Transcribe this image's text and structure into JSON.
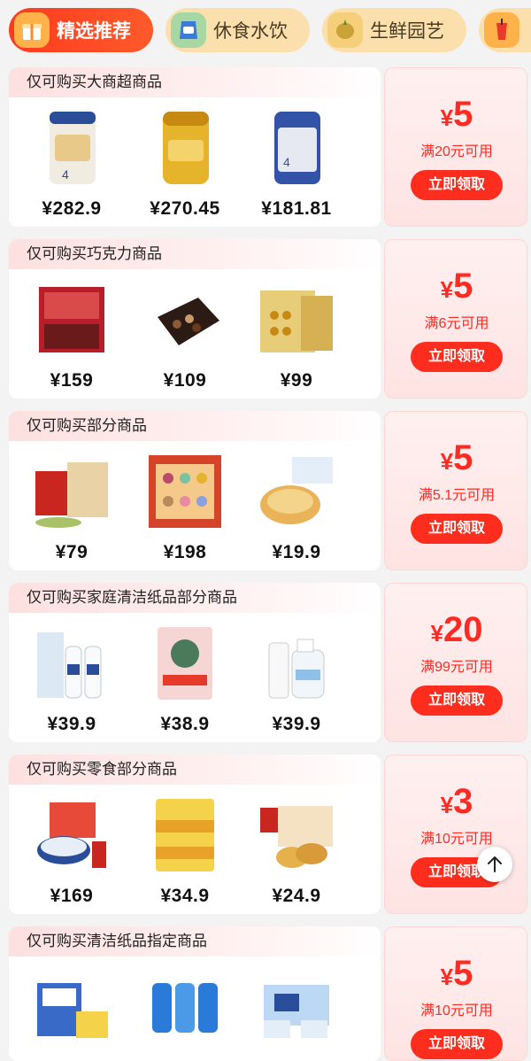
{
  "tabs": [
    {
      "label": "精选推荐",
      "icon": "gift-box-icon",
      "active": true
    },
    {
      "label": "休食水饮",
      "icon": "snack-bag-icon",
      "active": false
    },
    {
      "label": "生鲜园艺",
      "icon": "durian-icon",
      "active": false
    },
    {
      "label": "",
      "icon": "drink-cup-icon",
      "active": false
    }
  ],
  "cards": [
    {
      "title": "仅可购买大商超商品",
      "amount": "5",
      "currency": "¥",
      "condition": "满20元可用",
      "button": "立即领取",
      "products": [
        {
          "price": "¥282.9",
          "image": "infant-formula-can"
        },
        {
          "price": "¥270.45",
          "image": "gold-formula-can"
        },
        {
          "price": "¥181.81",
          "image": "blue-formula-can"
        }
      ]
    },
    {
      "title": "仅可购买巧克力商品",
      "amount": "5",
      "currency": "¥",
      "condition": "满6元可用",
      "button": "立即领取",
      "products": [
        {
          "price": "¥159",
          "image": "red-chocolate-box"
        },
        {
          "price": "¥109",
          "image": "dark-chocolate-box"
        },
        {
          "price": "¥99",
          "image": "gold-chocolate-box"
        }
      ]
    },
    {
      "title": "仅可购买部分商品",
      "amount": "5",
      "currency": "¥",
      "condition": "满5.1元可用",
      "button": "立即领取",
      "products": [
        {
          "price": "¥79",
          "image": "red-gift-box"
        },
        {
          "price": "¥198",
          "image": "mooncake-box"
        },
        {
          "price": "¥19.9",
          "image": "bread-pack"
        }
      ]
    },
    {
      "title": "仅可购买家庭清洁纸品部分商品",
      "amount": "20",
      "currency": "¥",
      "condition": "满99元可用",
      "button": "立即领取",
      "products": [
        {
          "price": "¥39.9",
          "image": "cleaning-foam-set"
        },
        {
          "price": "¥38.9",
          "image": "laundry-powder-bag"
        },
        {
          "price": "¥39.9",
          "image": "spray-bottles"
        }
      ]
    },
    {
      "title": "仅可购买零食部分商品",
      "amount": "3",
      "currency": "¥",
      "condition": "满10元可用",
      "button": "立即领取",
      "products": [
        {
          "price": "¥169",
          "image": "cookie-tin-gift"
        },
        {
          "price": "¥34.9",
          "image": "biscuit-packs"
        },
        {
          "price": "¥24.9",
          "image": "cracker-box"
        }
      ]
    },
    {
      "title": "仅可购买清洁纸品指定商品",
      "amount": "5",
      "currency": "¥",
      "condition": "满10元可用",
      "button": "立即领取",
      "products": [
        {
          "price": "",
          "image": "tissue-packs"
        },
        {
          "price": "",
          "image": "paper-rolls"
        },
        {
          "price": "",
          "image": "tissue-boxes"
        }
      ]
    }
  ],
  "back_to_top": {
    "icon": "arrow-up-icon"
  }
}
